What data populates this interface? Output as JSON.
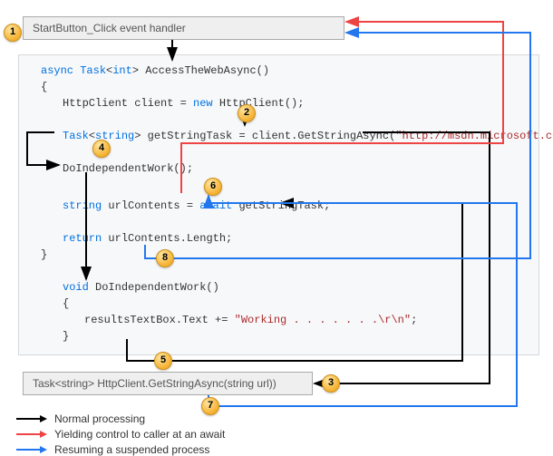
{
  "boxes": {
    "top": "StartButton_Click event handler",
    "bottom": "Task<string> HttpClient.GetStringAsync(string url))"
  },
  "code": {
    "l1a": "async",
    "l1b": "Task",
    "l1c": "int",
    "l1d": "> AccessTheWebAsync()",
    "l2": "{",
    "l3a": "HttpClient client = ",
    "l3b": "new",
    "l3c": " HttpClient();",
    "l4a": "Task",
    "l4b": "string",
    "l4c": "> getStringTask = client.GetStringAsync(",
    "l4d": "\"http://msdn.microsoft.com\"",
    "l4e": ");",
    "l5": "DoIndependentWork();",
    "l6a": "string",
    "l6b": " urlContents = ",
    "l6c": "await",
    "l6d": " getStringTask;",
    "l7a": "return",
    "l7b": " urlContents.Length;",
    "l8": "}",
    "l9a": "void",
    "l9b": " DoIndependentWork()",
    "l10": "{",
    "l11a": "resultsTextBox.Text += ",
    "l11b": "\"Working . . . . . . .\\r\\n\"",
    "l11c": ";",
    "l12": "}"
  },
  "markers": {
    "m1": "1",
    "m2": "2",
    "m3": "3",
    "m4": "4",
    "m5": "5",
    "m6": "6",
    "m7": "7",
    "m8": "8"
  },
  "legend": {
    "l1": "Normal processing",
    "l2": "Yielding control to caller at an await",
    "l3": "Resuming a suspended process"
  }
}
